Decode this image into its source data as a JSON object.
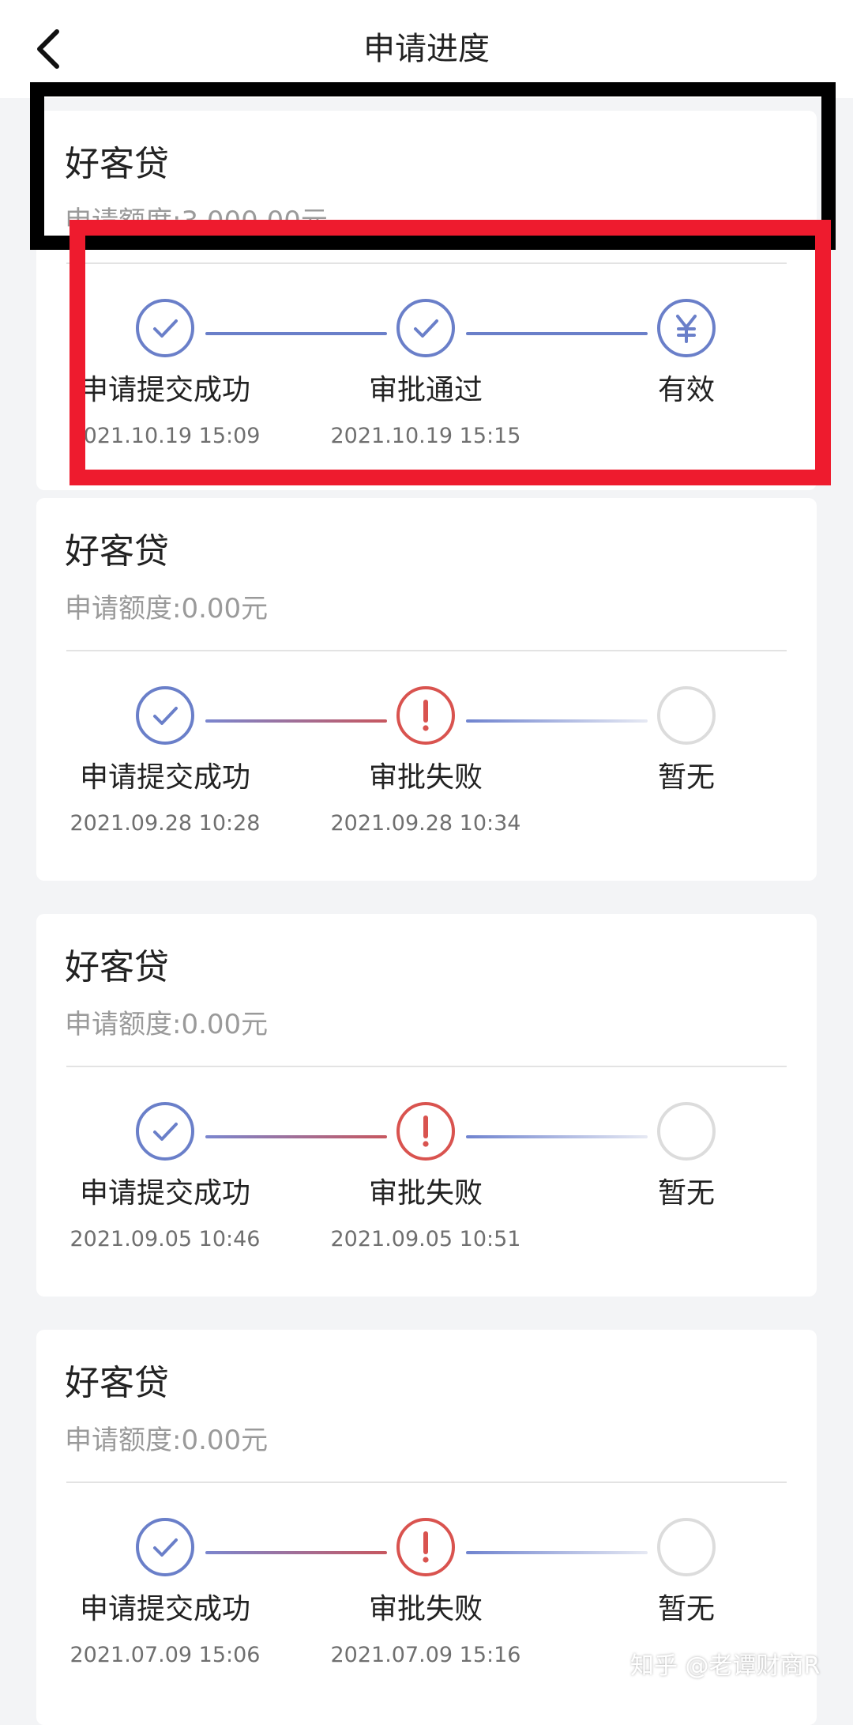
{
  "header": {
    "title": "申请进度",
    "back_icon": "chevron-left-icon"
  },
  "colors": {
    "step_done": "#6a7fc9",
    "step_failed": "#d9534f",
    "step_pending": "#dcdcdc",
    "annotation_black": "#000000",
    "annotation_red": "#ee1b2e"
  },
  "applications": [
    {
      "product": "好客贷",
      "amount": "申请额度:3,000.00元",
      "steps": [
        {
          "label": "申请提交成功",
          "time": "2021.10.19 15:09",
          "status": "done",
          "icon": "check-icon"
        },
        {
          "label": "审批通过",
          "time": "2021.10.19 15:15",
          "status": "done",
          "icon": "check-icon"
        },
        {
          "label": "有效",
          "time": "",
          "status": "active",
          "icon": "yen-icon"
        }
      ]
    },
    {
      "product": "好客贷",
      "amount": "申请额度:0.00元",
      "steps": [
        {
          "label": "申请提交成功",
          "time": "2021.09.28 10:28",
          "status": "done",
          "icon": "check-icon"
        },
        {
          "label": "审批失败",
          "time": "2021.09.28 10:34",
          "status": "failed",
          "icon": "exclamation-icon"
        },
        {
          "label": "暂无",
          "time": "",
          "status": "pending",
          "icon": "empty-circle-icon"
        }
      ]
    },
    {
      "product": "好客贷",
      "amount": "申请额度:0.00元",
      "steps": [
        {
          "label": "申请提交成功",
          "time": "2021.09.05 10:46",
          "status": "done",
          "icon": "check-icon"
        },
        {
          "label": "审批失败",
          "time": "2021.09.05 10:51",
          "status": "failed",
          "icon": "exclamation-icon"
        },
        {
          "label": "暂无",
          "time": "",
          "status": "pending",
          "icon": "empty-circle-icon"
        }
      ]
    },
    {
      "product": "好客贷",
      "amount": "申请额度:0.00元",
      "steps": [
        {
          "label": "申请提交成功",
          "time": "2021.07.09 15:06",
          "status": "done",
          "icon": "check-icon"
        },
        {
          "label": "审批失败",
          "time": "2021.07.09 15:16",
          "status": "failed",
          "icon": "exclamation-icon"
        },
        {
          "label": "暂无",
          "time": "",
          "status": "pending",
          "icon": "empty-circle-icon"
        }
      ]
    }
  ],
  "watermark": "知乎 @老谭财商R"
}
